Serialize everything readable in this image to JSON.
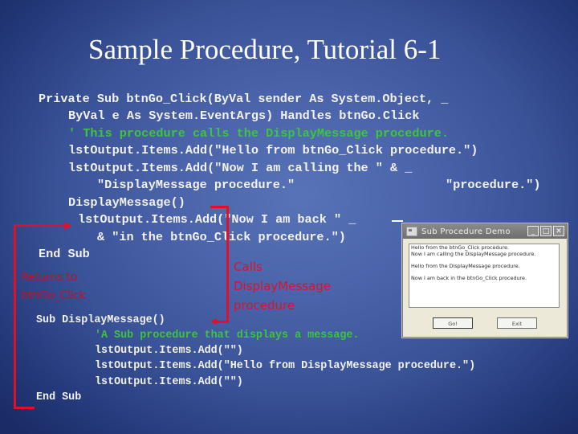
{
  "slide": {
    "title": "Sample Procedure, Tutorial 6-1"
  },
  "code_top": [
    {
      "text": "Private Sub btnGo_Click(ByVal sender As System.Object, _",
      "type": "code"
    },
    {
      "text": "ByVal e As System.EventArgs) Handles btnGo.Click",
      "type": "code"
    },
    {
      "text": "' This procedure calls the DisplayMessage procedure.",
      "type": "comment"
    },
    {
      "text": "lstOutput.Items.Add(\"Hello from btnGo_Click procedure.\")",
      "type": "code"
    },
    {
      "text": "lstOutput.Items.Add(\"Now I am calling the \" & _",
      "type": "code"
    },
    {
      "text": "\"DisplayMessage procedure.\"",
      "type": "code"
    },
    {
      "text": "\"procedure.\")",
      "type": "code"
    },
    {
      "text": "DisplayMessage()",
      "type": "code"
    },
    {
      "text": "lstOutput.Items.Add(\"Now I am back \" _",
      "type": "code"
    },
    {
      "text": "& \"in the btnGo_Click procedure.\")",
      "type": "code"
    },
    {
      "text": "End Sub",
      "type": "code"
    }
  ],
  "code_bottom": [
    {
      "text": "Sub DisplayMessage()",
      "type": "code"
    },
    {
      "text": "'A Sub procedure that displays a message.",
      "type": "comment"
    },
    {
      "text": "lstOutput.Items.Add(\"\")",
      "type": "code"
    },
    {
      "text": "lstOutput.Items.Add(\"Hello from DisplayMessage procedure.\")",
      "type": "code"
    },
    {
      "text": "lstOutput.Items.Add(\"\")",
      "type": "code"
    },
    {
      "text": "End Sub",
      "type": "code"
    }
  ],
  "annotations": {
    "calls": [
      "Calls",
      "DisplayMessage",
      "procedure"
    ],
    "returns": [
      "Returns to",
      "btnGo_Click"
    ]
  },
  "colors": {
    "code_text": "#f2f2f2",
    "comment": "#3ec43e",
    "annotation_red": "#d8142c"
  },
  "window": {
    "title": "Sub Procedure Demo",
    "controls": {
      "minimize": "_",
      "maximize": "□",
      "close": "✕"
    },
    "list_items": [
      "Hello from the btnGo_Click procedure.",
      "Now I am calling the DisplayMessage procedure.",
      "",
      "Hello from the DisplayMessage procedure.",
      "",
      "Now I am back in the btnGo_Click procedure."
    ],
    "buttons": {
      "go": "Go!",
      "exit": "Exit"
    }
  }
}
